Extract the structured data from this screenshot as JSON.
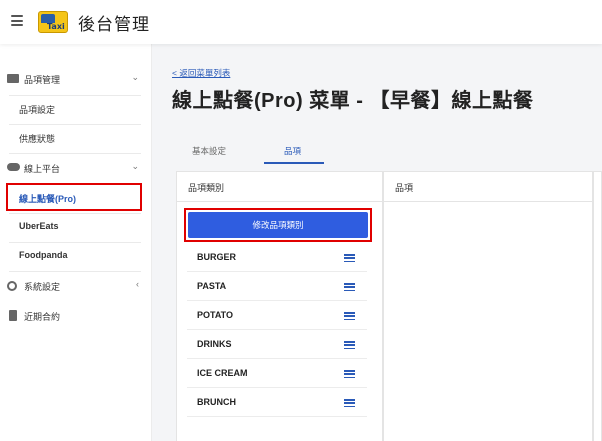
{
  "header": {
    "app_title": "後台管理",
    "logo_text": "Taxi"
  },
  "sidebar": {
    "items": [
      {
        "label": "品項管理",
        "icon": "folder-icon",
        "chevron": "⌄"
      },
      {
        "label": "品項設定"
      },
      {
        "label": "供應狀態"
      },
      {
        "label": "線上平台",
        "icon": "cloud-icon",
        "chevron": "⌄"
      },
      {
        "label": "線上點餐(Pro)"
      },
      {
        "label": "UberEats"
      },
      {
        "label": "Foodpanda"
      },
      {
        "label": "系統設定",
        "icon": "gear-icon",
        "chevron": "‹"
      },
      {
        "label": "近期合約",
        "icon": "document-icon"
      }
    ]
  },
  "main": {
    "back_link": "< 返回菜單列表",
    "title": "線上點餐(Pro) 菜單 - 【早餐】線上點餐",
    "tabs": [
      {
        "label": "基本設定"
      },
      {
        "label": "品項"
      }
    ],
    "left_panel_title": "品項類別",
    "edit_category_button": "修改品項類別",
    "categories": [
      "BURGER",
      "PASTA",
      "POTATO",
      "DRINKS",
      "ICE CREAM",
      "BRUNCH"
    ],
    "right_panel_title": "品項"
  },
  "colors": {
    "accent": "#2f5de0",
    "highlight": "#e00000",
    "link": "#2a5ab8"
  }
}
